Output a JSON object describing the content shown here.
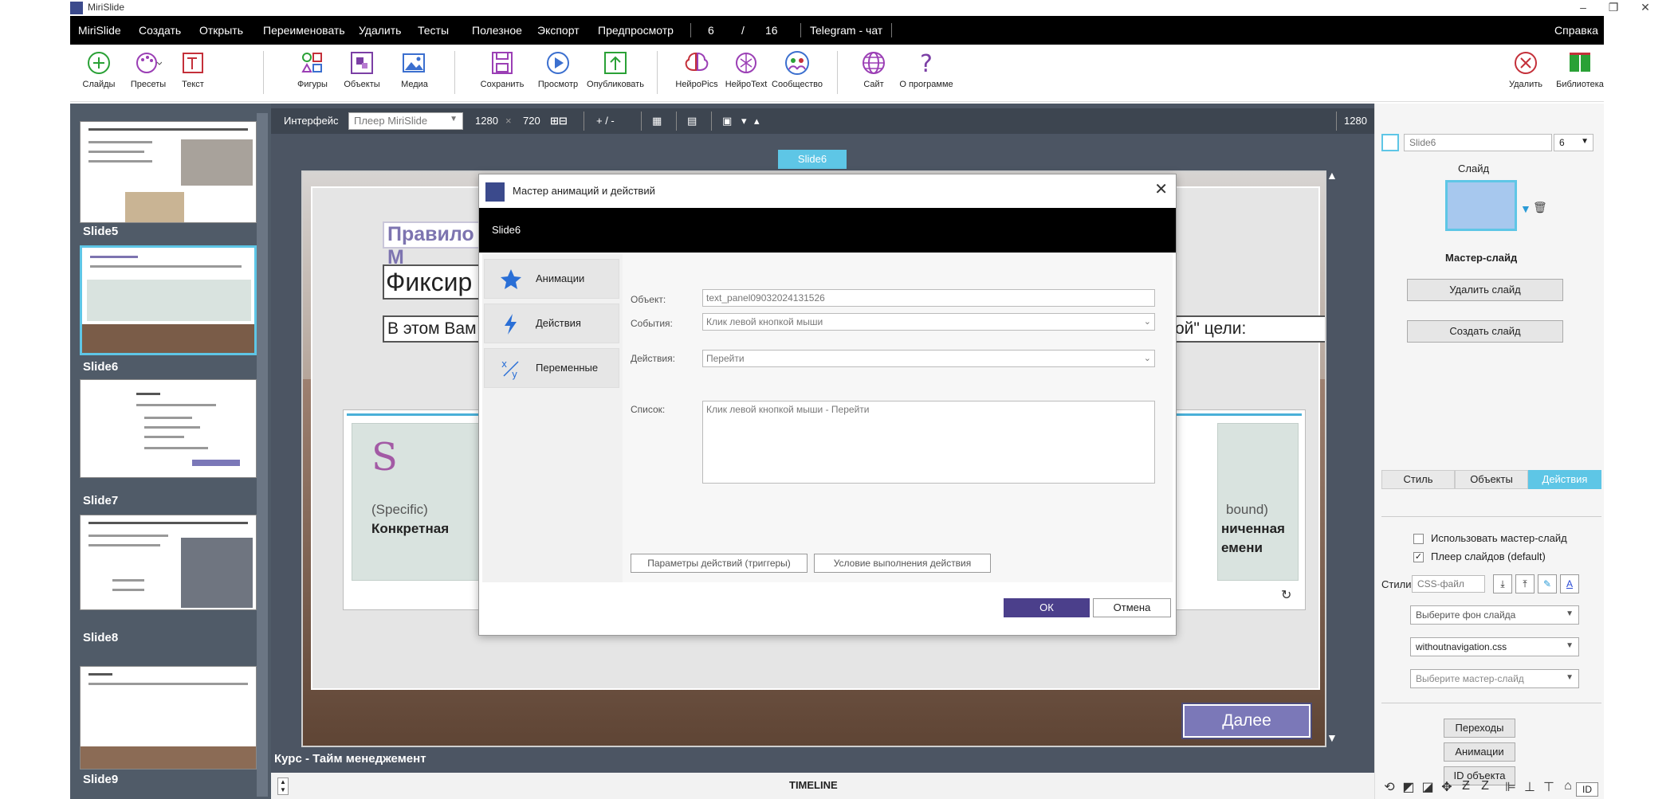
{
  "window": {
    "title": "MiriSlide"
  },
  "menu": {
    "items": [
      "MiriSlide",
      "Создать",
      "Открыть",
      "Переименовать",
      "Удалить",
      "Тесты",
      "Полезное",
      "Экспорт",
      "Предпросмотр"
    ],
    "page_current": "6",
    "page_sep": "/",
    "page_total": "16",
    "telegram": "Telegram - чат",
    "help": "Справка"
  },
  "toolbar": {
    "slides": "Слайды",
    "presets": "Пресеты",
    "text": "Текст",
    "shapes": "Фигуры",
    "objects": "Объекты",
    "media": "Медиа",
    "save": "Сохранить",
    "preview": "Просмотр",
    "publish": "Опубликовать",
    "neuropics": "НейроPics",
    "neurotext": "НейроText",
    "community": "Сообщество",
    "site": "Сайт",
    "about": "О программе",
    "delete": "Удалить",
    "library": "Библиотека"
  },
  "slides_panel": {
    "items": [
      {
        "label": "Slide5"
      },
      {
        "label": "Slide6"
      },
      {
        "label": "Slide7"
      },
      {
        "label": "Slide8"
      },
      {
        "label": "Slide9"
      }
    ]
  },
  "canvas_toolbar": {
    "interface_label": "Интерфейс",
    "player": "Плеер MiriSlide",
    "width": "1280",
    "times": "×",
    "height": "720",
    "zoom": "+ / -",
    "right_value": "1280"
  },
  "slide": {
    "tab": "Slide6",
    "heading": "Правило М",
    "title": "Фиксир",
    "text_left": "В этом Вам",
    "text_right": "ой\" цели:",
    "card_left": {
      "letter": "S",
      "sub": "(Specific)",
      "main": "Конкретная"
    },
    "card_right": {
      "sub": "bound)",
      "main1": "ниченная",
      "main2": "емени"
    },
    "next": "Далее"
  },
  "course_label": "Курс -  Тайм менеджемент",
  "timeline": "TIMELINE",
  "right_panel": {
    "slide_name": "Slide6",
    "slide_number": "6",
    "slide_label": "Слайд",
    "master_label": "Мастер-слайд",
    "delete_slide": "Удалить слайд",
    "create_slide": "Создать слайд",
    "tabs": [
      "Стиль",
      "Объекты",
      "Действия"
    ],
    "use_master": "Использовать мастер-слайд",
    "player_default": "Плеер слайдов (default)",
    "styles_label": "Стили:",
    "css_placeholder": "CSS-файл",
    "bg_select": "Выберите фон слайда",
    "css_select": "withoutnavigation.css",
    "master_select": "Выберите мастер-слайд",
    "transitions": "Переходы",
    "animations": "Анимации",
    "object_id": "ID объекта",
    "id_badge": "ID"
  },
  "dialog": {
    "title": "Мастер анимаций и действий",
    "header": "Slide6",
    "nav": [
      "Анимации",
      "Действия",
      "Переменные"
    ],
    "object_label": "Объект:",
    "object_value": "text_panel09032024131526",
    "events_label": "События:",
    "events_value": "Клик левой кнопкой мыши",
    "actions_label": "Действия:",
    "actions_value": "Перейти",
    "list_label": "Список:",
    "list_value": "Клик левой кнопкой мыши - Перейти",
    "params_btn": "Параметры действий (триггеры)",
    "condition_btn": "Условие выполнения действия",
    "ok": "ОК",
    "cancel": "Отмена"
  },
  "colors": {
    "accent": "#5ec6e6",
    "menu_bg": "#000000",
    "panel_dark": "#505b68",
    "ok_button": "#4b3f8b",
    "next_button": "#7b78b8"
  }
}
